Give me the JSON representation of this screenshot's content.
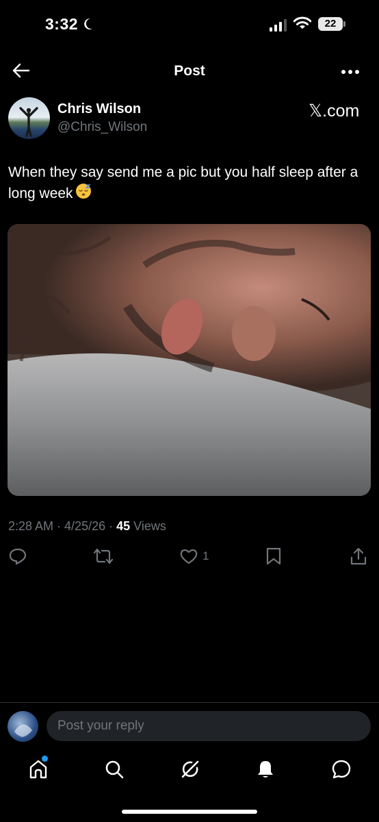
{
  "status_bar": {
    "time": "3:32",
    "battery": "22"
  },
  "header": {
    "title": "Post"
  },
  "post": {
    "author_name": "Chris Wilson",
    "author_handle": "@Chris_Wilson",
    "source": "𝕏.com",
    "text": "When they say send me a pic but you half sleep after a long week",
    "time": "2:28 AM",
    "date": "4/25/26",
    "views_count": "45",
    "views_label": "Views",
    "likes": "1"
  },
  "reply": {
    "placeholder": "Post your reply"
  },
  "icons": {
    "back": "back-arrow-icon",
    "more": "more-icon",
    "reply": "reply-icon",
    "repost": "repost-icon",
    "like": "heart-icon",
    "bookmark": "bookmark-icon",
    "share": "share-icon",
    "home": "home-icon",
    "search": "search-icon",
    "grok": "grok-icon",
    "notifications": "bell-icon",
    "messages": "message-icon"
  },
  "colors": {
    "accent": "#1d9bf0",
    "muted": "#71767b",
    "background": "#000000"
  }
}
